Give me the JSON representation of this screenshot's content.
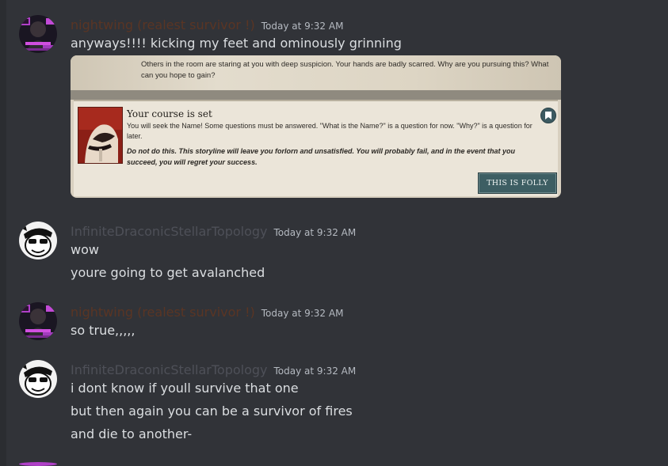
{
  "messages": [
    {
      "author": "nightwing (realest survivor !)",
      "timestamp": "Today at 9:32 AM",
      "lines": [
        "anyways!!!! kicking my feet and ominously grinning"
      ],
      "embed": {
        "top_text": "Others in the room are staring at you with deep suspicion. Your hands are badly scarred. Why are you pursuing this? What can you hope to gain?",
        "card_title": "Your course is set",
        "card_body": "You will seek the Name! Some questions must be answered. \"What is the Name?\" is a question for now. \"Why?\" is a question for later.",
        "card_warning": "Do not do this. This storyline will leave you forlorn and unsatisfied. You will probably fail, and in the event that you succeed, you will regret your success.",
        "button_label": "THIS IS FOLLY",
        "bookmark_icon": "bookmark-icon"
      }
    },
    {
      "author": "InfiniteDraconicStellarTopology",
      "timestamp": "Today at 9:32 AM",
      "lines": [
        "wow",
        "youre going to get avalanched"
      ]
    },
    {
      "author": "nightwing (realest survivor !)",
      "timestamp": "Today at 9:32 AM",
      "lines": [
        "so true,,,,,"
      ]
    },
    {
      "author": "InfiniteDraconicStellarTopology",
      "timestamp": "Today at 9:32 AM",
      "lines": [
        "i dont know if youll survive that one",
        "but then again you can be a survivor of fires",
        "and die to another-"
      ]
    }
  ],
  "colors": {
    "background": "#313338",
    "text": "#dbdee1",
    "timestamp": "#b5bac1",
    "author_nightwing": "#5a3524",
    "author_infinite": "#4e5058",
    "embed_button": "#3d5e63"
  }
}
